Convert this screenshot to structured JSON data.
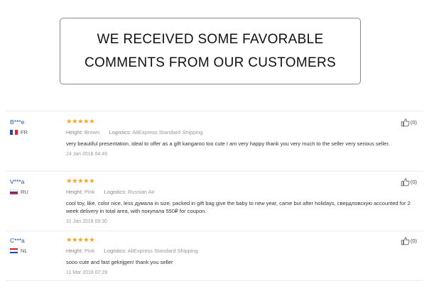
{
  "banner": {
    "line1": "WE RECEIVED SOME FAVORABLE",
    "line2": "COMMENTS FROM OUR CUSTOMERS"
  },
  "reviews": [
    {
      "user": "B***e",
      "country": "FR",
      "stars": "★★★★★",
      "height_key": "Height:",
      "height_val": "Brown",
      "logistics_key": "Logistics:",
      "logistics_val": "AliExpress Standard Shipping",
      "text": "very beautiful presentation, ideal to offer as a gift kangaroo too cute I am very happy thank you very much to the seller very serious seller.",
      "date": "24 Jan 2018 04:49",
      "likes": "(0)"
    },
    {
      "user": "V***a",
      "country": "RU",
      "stars": "★★★★★",
      "height_key": "Height:",
      "height_val": "Pink",
      "logistics_key": "Logistics:",
      "logistics_val": "Russian Air",
      "text": "cool toy, like, color nice, less думала in size, packed in gift bag give the baby to new year, came but after holidays, свердловскую accounted for 2 week delivery in total area, with покупала 550₽ for coupon.",
      "date": "31 Jan 2018 09:30",
      "likes": "(0)"
    },
    {
      "user": "C***a",
      "country": "NL",
      "stars": "★★★★★",
      "height_key": "Height:",
      "height_val": "Pink",
      "logistics_key": "Logistics:",
      "logistics_val": "AliExpress Standard Shipping",
      "text": "sooo cute and fast gekrijgen! thank you seller",
      "date": "11 Mar 2018 07:28",
      "likes": "(0)"
    }
  ],
  "flag_colors": {
    "FR": [
      "#1f4aa8",
      "#ffffff",
      "#e3262f"
    ],
    "RU": [
      "#ffffff",
      "#1f4aa8",
      "#e3262f"
    ],
    "NL": [
      "#c8202a",
      "#ffffff",
      "#1f4aa8"
    ]
  },
  "icons": {
    "like": "thumbs-up-icon"
  }
}
